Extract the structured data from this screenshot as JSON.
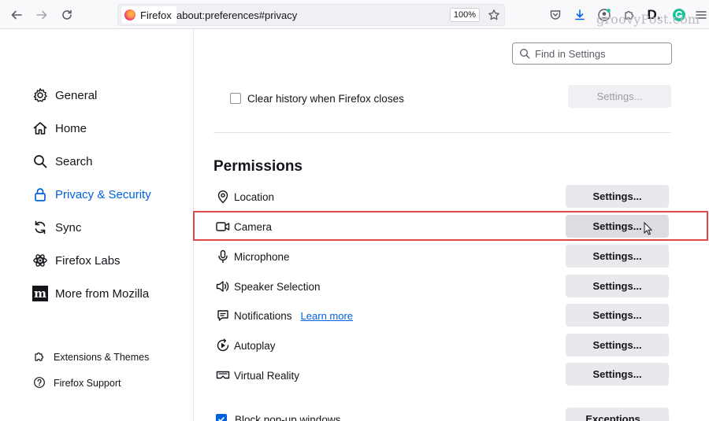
{
  "toolbar": {
    "identity_label": "Firefox",
    "url": "about:preferences#privacy",
    "zoom": "100%",
    "watermark": "groovyPost.com"
  },
  "sidebar": {
    "items": [
      {
        "label": "General",
        "icon": "gear-icon"
      },
      {
        "label": "Home",
        "icon": "home-icon"
      },
      {
        "label": "Search",
        "icon": "search-icon"
      },
      {
        "label": "Privacy & Security",
        "icon": "lock-icon",
        "active": true
      },
      {
        "label": "Sync",
        "icon": "sync-icon"
      },
      {
        "label": "Firefox Labs",
        "icon": "labs-icon"
      },
      {
        "label": "More from Mozilla",
        "icon": "mozilla-icon"
      }
    ],
    "footer": [
      {
        "label": "Extensions & Themes",
        "icon": "puzzle-icon"
      },
      {
        "label": "Firefox Support",
        "icon": "help-icon"
      }
    ]
  },
  "find": {
    "placeholder": "Find in Settings"
  },
  "history": {
    "clear_label": "Clear history when Firefox closes",
    "settings_label": "Settings..."
  },
  "permissions": {
    "title": "Permissions",
    "items": [
      {
        "label": "Location",
        "button": "Settings..."
      },
      {
        "label": "Camera",
        "button": "Settings..."
      },
      {
        "label": "Microphone",
        "button": "Settings..."
      },
      {
        "label": "Speaker Selection",
        "button": "Settings..."
      },
      {
        "label": "Notifications",
        "link": "Learn more",
        "button": "Settings..."
      },
      {
        "label": "Autoplay",
        "button": "Settings..."
      },
      {
        "label": "Virtual Reality",
        "button": "Settings..."
      }
    ],
    "block_popups": {
      "label": "Block pop-up windows",
      "button": "Exceptions..."
    }
  },
  "colors": {
    "accent": "#0061e0",
    "highlight": "#e04848"
  }
}
